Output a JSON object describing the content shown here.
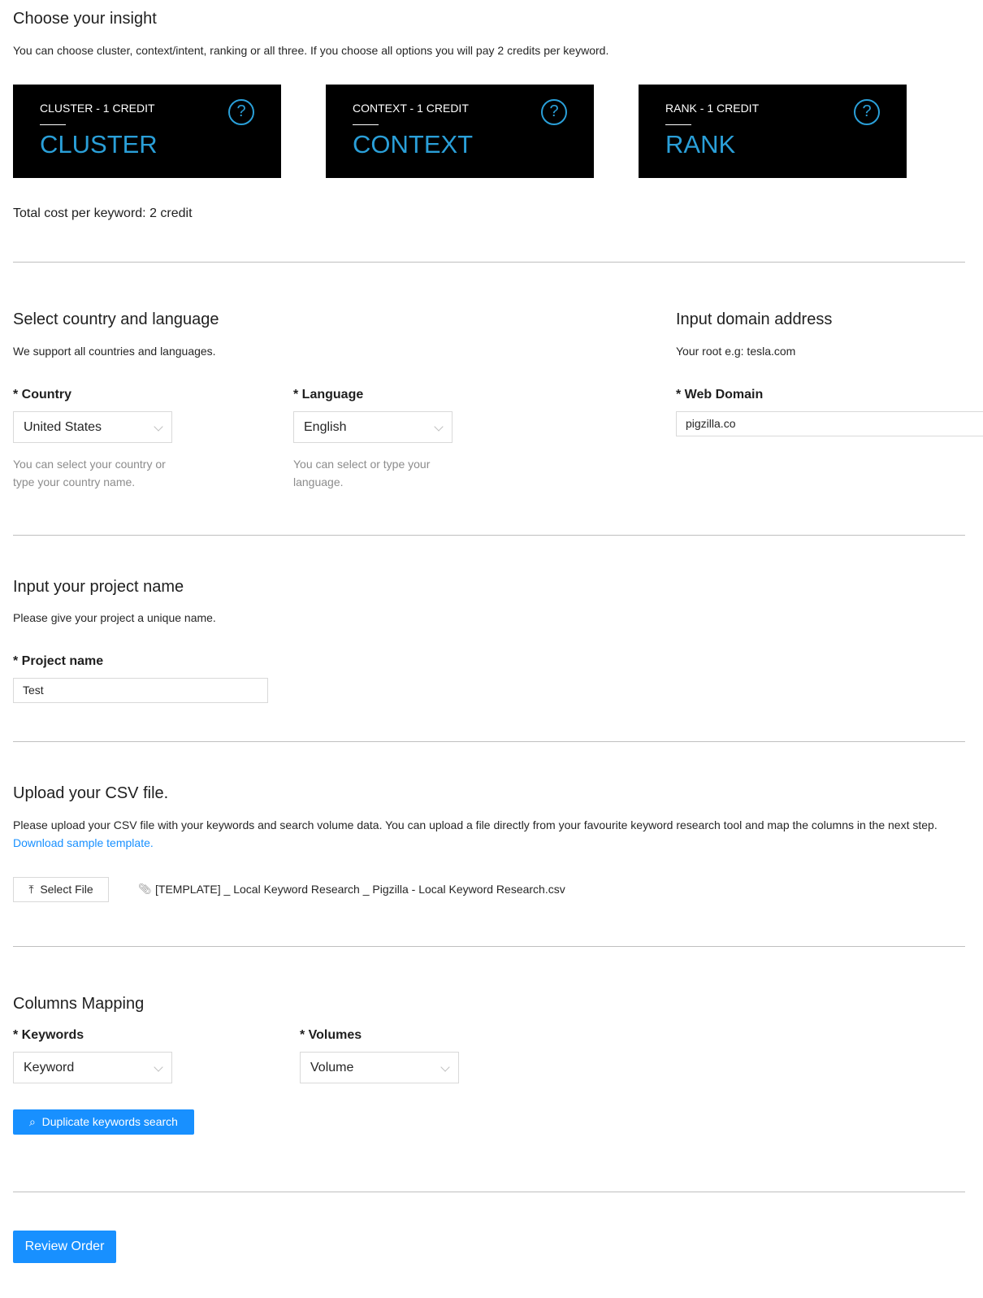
{
  "insight": {
    "title": "Choose your insight",
    "description": "You can choose cluster, context/intent, ranking or all three. If you choose all options you will pay 2 credits per keyword.",
    "cards": [
      {
        "subtitle": "CLUSTER - 1 CREDIT",
        "name": "CLUSTER"
      },
      {
        "subtitle": "CONTEXT - 1 CREDIT",
        "name": "CONTEXT"
      },
      {
        "subtitle": "RANK - 1 CREDIT",
        "name": "RANK"
      }
    ],
    "help_glyph": "?",
    "total": "Total cost per keyword: 2 credit"
  },
  "country_language": {
    "title": "Select country and language",
    "description": "We support all countries and languages.",
    "country": {
      "label": "* Country",
      "value": "United States",
      "help": "You can select your country or type your country name."
    },
    "language": {
      "label": "* Language",
      "value": "English",
      "help": "You can select or type your language."
    }
  },
  "domain": {
    "title": "Input domain address",
    "description": "Your root e.g: tesla.com",
    "label": "* Web Domain",
    "value": "pigzilla.co"
  },
  "project": {
    "title": "Input your project name",
    "description": "Please give your project a unique name.",
    "label": "* Project name",
    "value": "Test"
  },
  "upload": {
    "title": "Upload your CSV file.",
    "description": "Please upload your CSV file with your keywords and search volume data. You can upload a file directly from your favourite keyword research tool and map the columns in the next step.",
    "link": "Download sample template.",
    "button": "Select File",
    "file": "[TEMPLATE] _ Local Keyword Research _ Pigzilla - Local Keyword Research.csv"
  },
  "mapping": {
    "title": "Columns Mapping",
    "keywords": {
      "label": "* Keywords",
      "value": "Keyword"
    },
    "volumes": {
      "label": "* Volumes",
      "value": "Volume"
    },
    "search_button": "Duplicate keywords search"
  },
  "review_button": "Review Order",
  "colors": {
    "primary": "#1890ff",
    "card_accent": "#2a9fd8"
  }
}
